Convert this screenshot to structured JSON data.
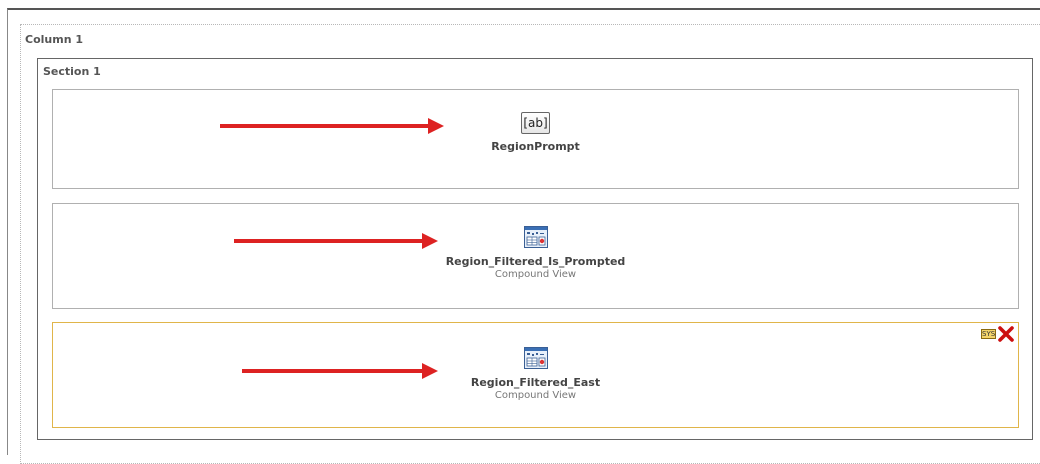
{
  "layout": {
    "column_label": "Column 1",
    "section_label": "Section 1"
  },
  "views": [
    {
      "name": "RegionPrompt",
      "type": "",
      "icon": "text-prompt-icon"
    },
    {
      "name": "Region_Filtered_Is_Prompted",
      "type": "Compound View",
      "icon": "compound-view-icon"
    },
    {
      "name": "Region_Filtered_East",
      "type": "Compound View",
      "icon": "compound-view-icon",
      "selected": true
    }
  ],
  "colors": {
    "arrow": "#dd2222",
    "selected_border": "#e0b54a"
  }
}
